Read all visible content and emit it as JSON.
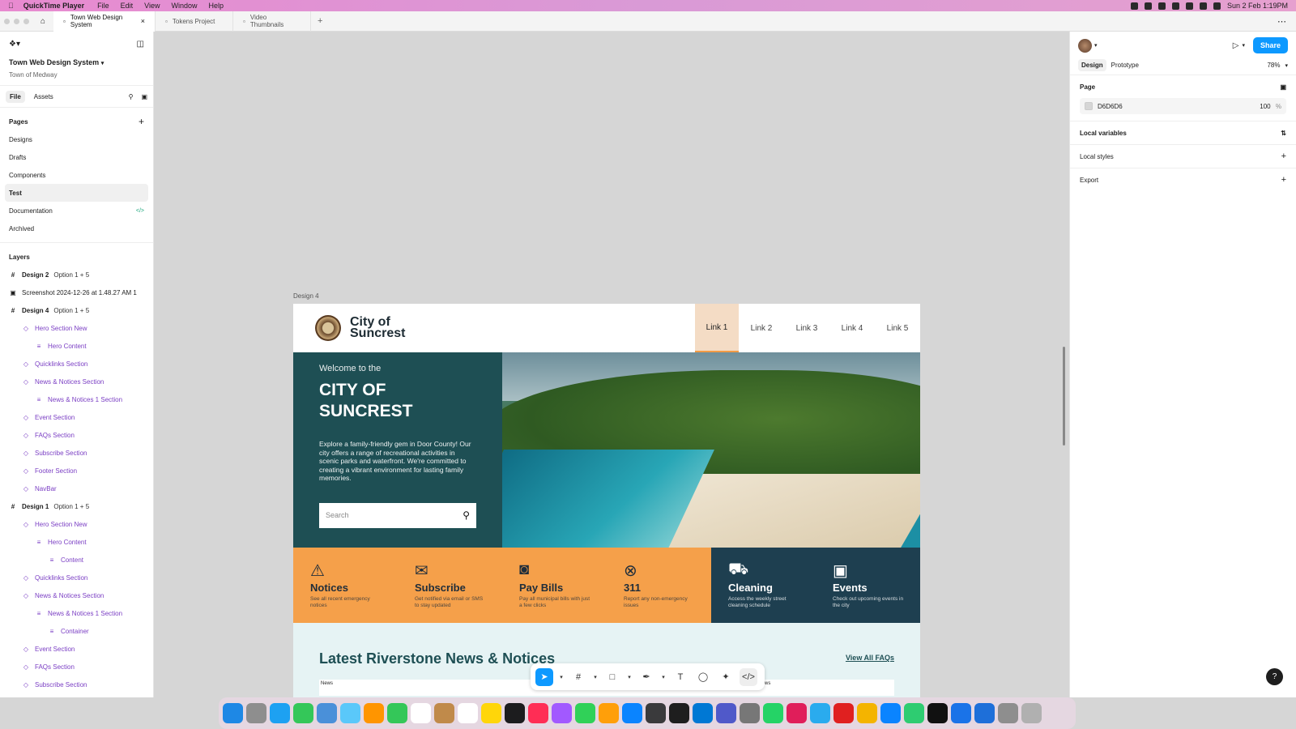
{
  "menubar": {
    "app": "QuickTime Player",
    "items": [
      "File",
      "Edit",
      "View",
      "Window",
      "Help"
    ],
    "datetime": "Sun 2 Feb  1:19PM"
  },
  "tabs": [
    {
      "label": "Town Web Design System",
      "active": true
    },
    {
      "label": "Tokens Project",
      "active": false
    },
    {
      "label": "Video Thumbnails",
      "active": false
    }
  ],
  "left": {
    "file_title": "Town Web Design System",
    "file_sub": "Town of Medway",
    "tab_file": "File",
    "tab_assets": "Assets",
    "pages_header": "Pages",
    "pages": [
      "Designs",
      "Drafts",
      "Components",
      "Test",
      "Documentation",
      "Archived"
    ],
    "selected_page": "Test",
    "layers_header": "Layers",
    "layers": [
      {
        "name": "Design 2",
        "opt": "Option 1 + 5",
        "indent": 0,
        "type": "frame"
      },
      {
        "name": "Screenshot 2024-12-26 at 1.48.27 AM 1",
        "opt": "",
        "indent": 0,
        "type": "image"
      },
      {
        "name": "Design 4",
        "opt": "Option 1 + 5",
        "indent": 0,
        "type": "frame"
      },
      {
        "name": "Hero Section New",
        "opt": "",
        "indent": 1,
        "type": "comp"
      },
      {
        "name": "Hero Content",
        "opt": "",
        "indent": 2,
        "type": "comp"
      },
      {
        "name": "Quicklinks Section",
        "opt": "",
        "indent": 1,
        "type": "comp"
      },
      {
        "name": "News & Notices Section",
        "opt": "",
        "indent": 1,
        "type": "comp"
      },
      {
        "name": "News & Notices 1 Section",
        "opt": "",
        "indent": 2,
        "type": "comp"
      },
      {
        "name": "Event Section",
        "opt": "",
        "indent": 1,
        "type": "comp"
      },
      {
        "name": "FAQs Section",
        "opt": "",
        "indent": 1,
        "type": "comp"
      },
      {
        "name": "Subscribe Section",
        "opt": "",
        "indent": 1,
        "type": "comp"
      },
      {
        "name": "Footer Section",
        "opt": "",
        "indent": 1,
        "type": "comp"
      },
      {
        "name": "NavBar",
        "opt": "",
        "indent": 1,
        "type": "comp"
      },
      {
        "name": "Design 1",
        "opt": "Option 1 + 5",
        "indent": 0,
        "type": "frame"
      },
      {
        "name": "Hero Section New",
        "opt": "",
        "indent": 1,
        "type": "comp"
      },
      {
        "name": "Hero Content",
        "opt": "",
        "indent": 2,
        "type": "comp"
      },
      {
        "name": "Content",
        "opt": "",
        "indent": 3,
        "type": "comp"
      },
      {
        "name": "Quicklinks Section",
        "opt": "",
        "indent": 1,
        "type": "comp"
      },
      {
        "name": "News & Notices Section",
        "opt": "",
        "indent": 1,
        "type": "comp"
      },
      {
        "name": "News & Notices 1 Section",
        "opt": "",
        "indent": 2,
        "type": "comp"
      },
      {
        "name": "Container",
        "opt": "",
        "indent": 3,
        "type": "comp"
      },
      {
        "name": "Event Section",
        "opt": "",
        "indent": 1,
        "type": "comp"
      },
      {
        "name": "FAQs Section",
        "opt": "",
        "indent": 1,
        "type": "comp"
      },
      {
        "name": "Subscribe Section",
        "opt": "",
        "indent": 1,
        "type": "comp"
      }
    ]
  },
  "canvas": {
    "frame_label": "Design 4",
    "site": {
      "city_name": "City of Suncrest",
      "nav_links": [
        "Link 1",
        "Link 2",
        "Link 3",
        "Link 4",
        "Link 5"
      ],
      "welcome": "Welcome to the",
      "hero_title": "CITY OF SUNCREST",
      "hero_text": "Explore a family-friendly gem in Door County! Our city offers a range of recreational activities in scenic parks and waterfront. We're committed to creating a vibrant environment for lasting family memories.",
      "search_placeholder": "Search",
      "quicklinks": [
        {
          "title": "Notices",
          "desc": "See all recent emergency notices",
          "icon": "⚠",
          "style": "orange"
        },
        {
          "title": "Subscribe",
          "desc": "Get notified via email or SMS to stay updated",
          "icon": "✉",
          "style": "orange"
        },
        {
          "title": "Pay Bills",
          "desc": "Pay all municipal bills with just a few clicks",
          "icon": "◙",
          "style": "orange"
        },
        {
          "title": "311",
          "desc": "Report any non-emergency issues",
          "icon": "⊗",
          "style": "orange"
        },
        {
          "title": "Cleaning",
          "desc": "Access the weekly street cleaning schedule",
          "icon": "⛟",
          "style": "dark"
        },
        {
          "title": "Events",
          "desc": "Check out upcoming events in the city",
          "icon": "▣",
          "style": "dark"
        }
      ],
      "news_title": "Latest Riverstone News & Notices",
      "news_link": "View All FAQs",
      "news_tag": "News",
      "news_tag_right": "ws"
    }
  },
  "right": {
    "tab_design": "Design",
    "tab_prototype": "Prototype",
    "zoom": "78%",
    "share": "Share",
    "page_header": "Page",
    "page_color": "D6D6D6",
    "page_opacity": "100",
    "percent": "%",
    "local_variables": "Local variables",
    "local_styles": "Local styles",
    "export": "Export"
  },
  "help": "?"
}
